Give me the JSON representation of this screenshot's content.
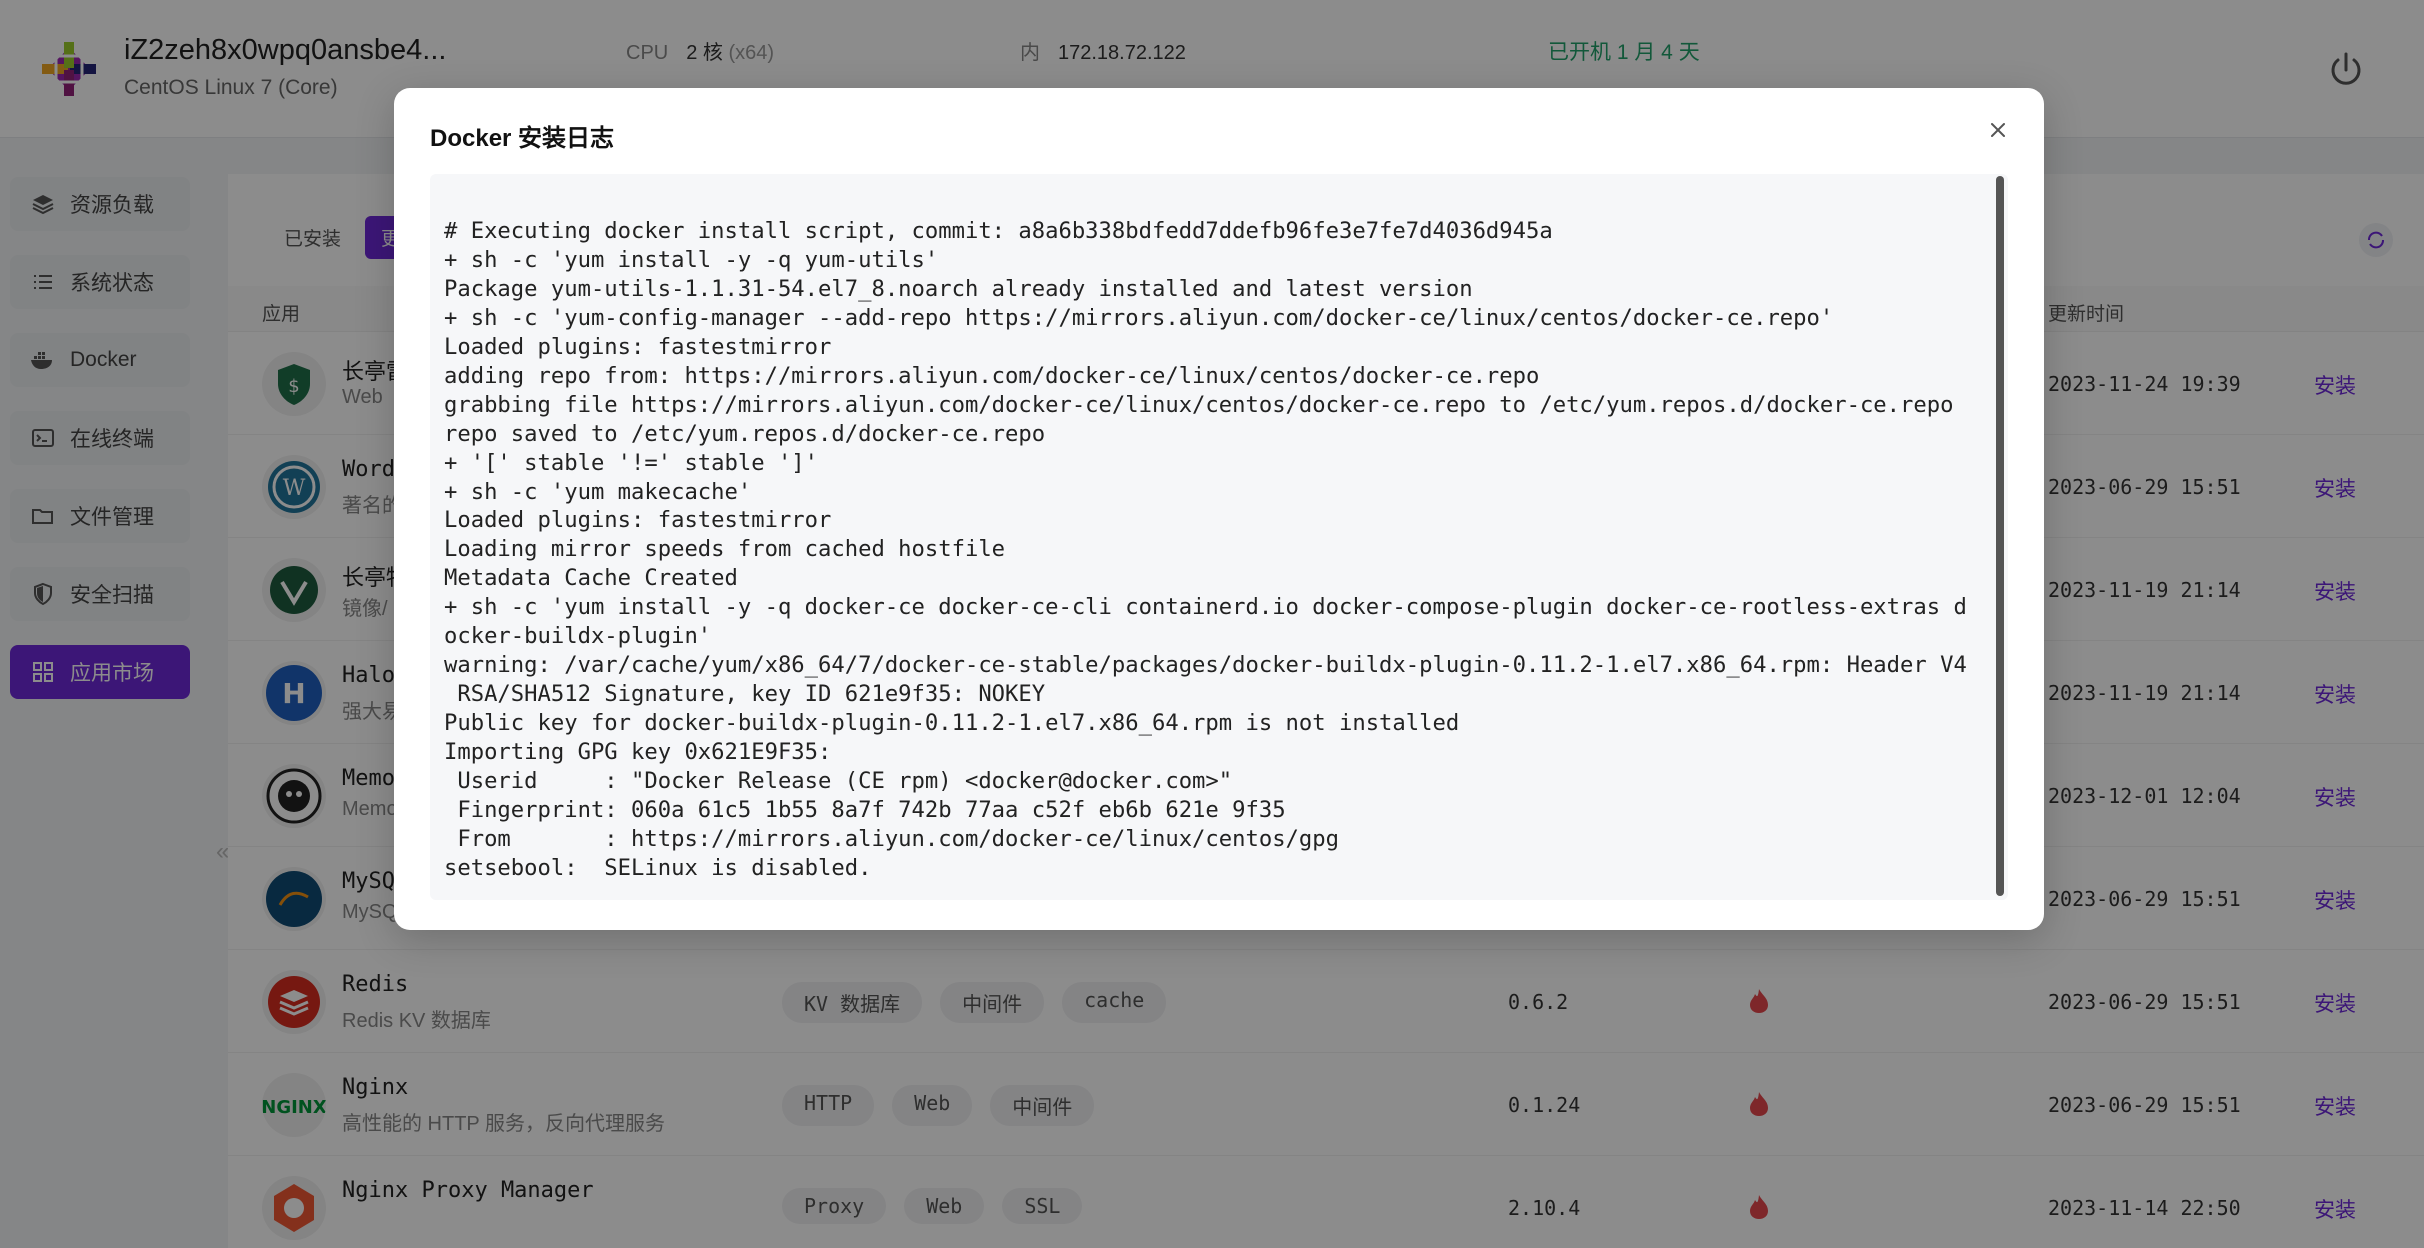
{
  "header": {
    "host_name": "iZ2zeh8x0wpq0ansbe4...",
    "os": "CentOS Linux 7 (Core)",
    "cpu_label": "CPU",
    "cpu_value": "2 核",
    "cpu_arch": "(x64)",
    "ip_label": "内",
    "ip_value": "172.18.72.122",
    "uptime": "已开机 1 月 4 天",
    "accent_color": "#6d28d9"
  },
  "sidebar": {
    "items": [
      {
        "label": "资源负载",
        "icon": "layers-icon"
      },
      {
        "label": "系统状态",
        "icon": "list-icon"
      },
      {
        "label": "Docker",
        "icon": "docker-icon"
      },
      {
        "label": "在线终端",
        "icon": "terminal-icon"
      },
      {
        "label": "文件管理",
        "icon": "folder-icon"
      },
      {
        "label": "安全扫描",
        "icon": "shield-icon"
      },
      {
        "label": "应用市场",
        "icon": "apps-icon"
      }
    ],
    "active_index": 6
  },
  "main": {
    "tabs": [
      "已安装",
      "更"
    ],
    "columns": {
      "app": "应用",
      "updated": "更新时间"
    },
    "install_label": "安装",
    "rows": [
      {
        "name": "长亭雷",
        "desc": "Web",
        "tags": [],
        "version": "",
        "updated": "2023-11-24 19:39"
      },
      {
        "name": "Word",
        "desc": "著名的",
        "tags": [],
        "version": "",
        "updated": "2023-06-29 15:51"
      },
      {
        "name": "长亭牧",
        "desc": "镜像/",
        "tags": [],
        "version": "",
        "updated": "2023-11-19 21:14"
      },
      {
        "name": "Halo",
        "desc": "强大易",
        "tags": [],
        "version": "",
        "updated": "2023-11-19 21:14"
      },
      {
        "name": "Memo",
        "desc": "Memo",
        "tags": [],
        "version": "",
        "updated": "2023-12-01 12:04"
      },
      {
        "name": "MySQ",
        "desc": "MySQ",
        "tags": [],
        "version": "",
        "updated": "2023-06-29 15:51"
      },
      {
        "name": "Redis",
        "desc": "Redis KV 数据库",
        "tags": [
          "KV 数据库",
          "中间件",
          "cache"
        ],
        "version": "0.6.2",
        "updated": "2023-06-29 15:51"
      },
      {
        "name": "Nginx",
        "desc": "高性能的 HTTP 服务，反向代理服务",
        "tags": [
          "HTTP",
          "Web",
          "中间件"
        ],
        "version": "0.1.24",
        "updated": "2023-06-29 15:51"
      },
      {
        "name": "Nginx Proxy Manager",
        "desc": "",
        "tags": [
          "Proxy",
          "Web",
          "SSL"
        ],
        "version": "2.10.4",
        "updated": "2023-11-14 22:50"
      }
    ]
  },
  "modal": {
    "title": "Docker 安装日志",
    "close_icon": "close-icon",
    "log_lines": [
      "# Executing docker install script, commit: a8a6b338bdfedd7ddefb96fe3e7fe7d4036d945a",
      "+ sh -c 'yum install -y -q yum-utils'",
      "Package yum-utils-1.1.31-54.el7_8.noarch already installed and latest version",
      "+ sh -c 'yum-config-manager --add-repo https://mirrors.aliyun.com/docker-ce/linux/centos/docker-ce.repo'",
      "Loaded plugins: fastestmirror",
      "adding repo from: https://mirrors.aliyun.com/docker-ce/linux/centos/docker-ce.repo",
      "grabbing file https://mirrors.aliyun.com/docker-ce/linux/centos/docker-ce.repo to /etc/yum.repos.d/docker-ce.repo",
      "repo saved to /etc/yum.repos.d/docker-ce.repo",
      "+ '[' stable '!=' stable ']'",
      "+ sh -c 'yum makecache'",
      "Loaded plugins: fastestmirror",
      "Loading mirror speeds from cached hostfile",
      "Metadata Cache Created",
      "+ sh -c 'yum install -y -q docker-ce docker-ce-cli containerd.io docker-compose-plugin docker-ce-rootless-extras d",
      "ocker-buildx-plugin'",
      "warning: /var/cache/yum/x86_64/7/docker-ce-stable/packages/docker-buildx-plugin-0.11.2-1.el7.x86_64.rpm: Header V4",
      " RSA/SHA512 Signature, key ID 621e9f35: NOKEY",
      "Public key for docker-buildx-plugin-0.11.2-1.el7.x86_64.rpm is not installed",
      "Importing GPG key 0x621E9F35:",
      " Userid     : \"Docker Release (CE rpm) <docker@docker.com>\"",
      " Fingerprint: 060a 61c5 1b55 8a7f 742b 77aa c52f eb6b 621e 9f35",
      " From       : https://mirrors.aliyun.com/docker-ce/linux/centos/gpg",
      "setsebool:  SELinux is disabled."
    ]
  }
}
